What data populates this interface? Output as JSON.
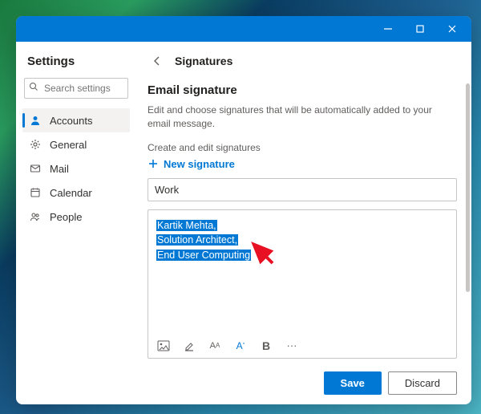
{
  "sidebar": {
    "title": "Settings",
    "search_placeholder": "Search settings",
    "items": [
      {
        "label": "Accounts",
        "icon": "person"
      },
      {
        "label": "General",
        "icon": "gear"
      },
      {
        "label": "Mail",
        "icon": "mail"
      },
      {
        "label": "Calendar",
        "icon": "calendar"
      },
      {
        "label": "People",
        "icon": "people"
      }
    ]
  },
  "page": {
    "title": "Signatures",
    "section_title": "Email signature",
    "section_desc": "Edit and choose signatures that will be automatically added to your email message.",
    "subsection_label": "Create and edit signatures",
    "new_signature_label": "New signature"
  },
  "signature": {
    "name": "Work",
    "lines": [
      "Kartik Mehta,",
      "Solution Architect,",
      "End User Computing"
    ]
  },
  "footer": {
    "save_label": "Save",
    "discard_label": "Discard"
  }
}
